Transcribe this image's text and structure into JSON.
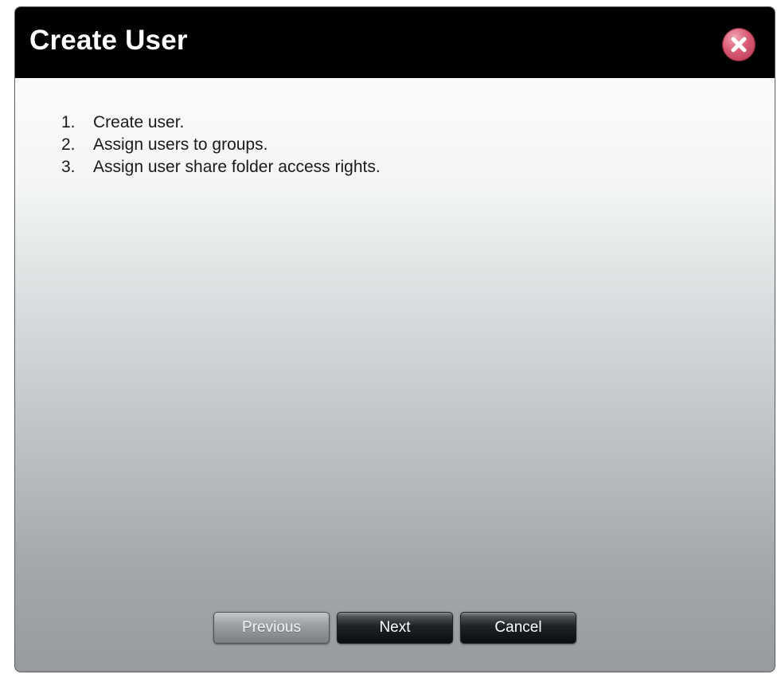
{
  "dialog": {
    "title": "Create User",
    "close_icon": "close-x-icon"
  },
  "steps": [
    {
      "number": "1.",
      "text": "Create user."
    },
    {
      "number": "2.",
      "text": "Assign users to groups."
    },
    {
      "number": "3.",
      "text": "Assign user share folder access rights."
    }
  ],
  "buttons": {
    "previous": "Previous",
    "next": "Next",
    "cancel": "Cancel"
  },
  "colors": {
    "titlebar": "#000000",
    "close_button": "#d85a73",
    "button_dark": "#1e2226",
    "button_disabled": "#9ca0a3"
  }
}
